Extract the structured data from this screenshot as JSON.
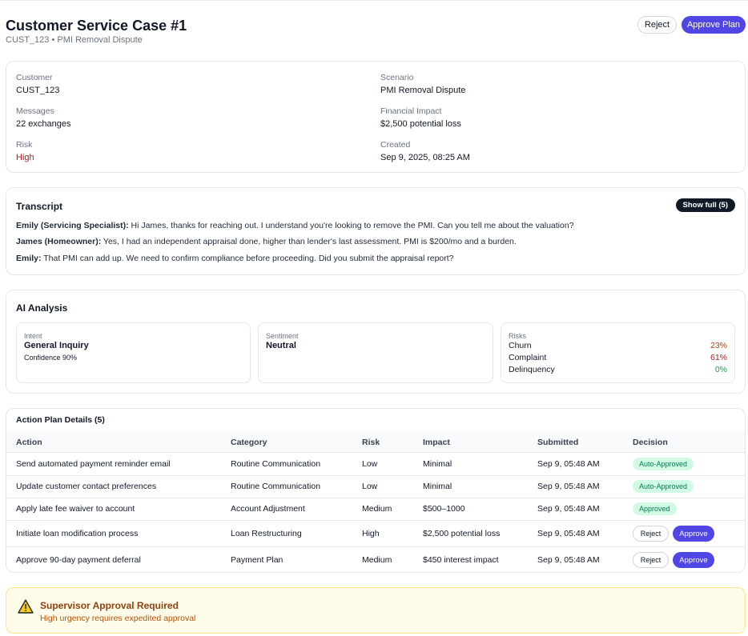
{
  "header": {
    "title": "Customer Service Case #1",
    "subtitle": "CUST_123 • PMI Removal Dispute",
    "reject_label": "Reject",
    "approve_label": "Approve Plan"
  },
  "info": {
    "customer": {
      "label": "Customer",
      "value": "CUST_123"
    },
    "messages": {
      "label": "Messages",
      "value": "22 exchanges"
    },
    "risk": {
      "label": "Risk",
      "value": "High"
    },
    "scenario": {
      "label": "Scenario",
      "value": "PMI Removal Dispute"
    },
    "financial": {
      "label": "Financial Impact",
      "value": "$2,500 potential loss"
    },
    "created": {
      "label": "Created",
      "value": "Sep 9, 2025, 08:25 AM"
    }
  },
  "transcript": {
    "title": "Transcript",
    "show_full_label": "Show full (5)",
    "messages": [
      {
        "speaker": "Emily (Servicing Specialist):",
        "text": " Hi James, thanks for reaching out. I understand you're looking to remove the PMI. Can you tell me about the valuation?"
      },
      {
        "speaker": "James (Homeowner):",
        "text": " Yes, I had an independent appraisal done, higher than lender's last assessment. PMI is $200/mo and a burden."
      },
      {
        "speaker": "Emily:",
        "text": " That PMI can add up. We need to confirm compliance before proceeding. Did you submit the appraisal report?"
      }
    ]
  },
  "ai": {
    "title": "AI Analysis",
    "intent": {
      "label": "Intent",
      "value": "General Inquiry",
      "confidence": "Confidence 90%"
    },
    "sentiment": {
      "label": "Sentiment",
      "value": "Neutral"
    },
    "risks": {
      "label": "Risks",
      "items": [
        {
          "name": "Churn",
          "value": "23%",
          "color": "#c2410c"
        },
        {
          "name": "Complaint",
          "value": "61%",
          "color": "#b91c1c"
        },
        {
          "name": "Delinquency",
          "value": "0%",
          "color": "#16a34a"
        }
      ]
    }
  },
  "plan": {
    "title": "Action Plan Details (5)",
    "columns": [
      "Action",
      "Category",
      "Risk",
      "Impact",
      "Submitted",
      "Decision"
    ],
    "rows": [
      {
        "action": "Send automated payment reminder email",
        "category": "Routine Communication",
        "risk": "Low",
        "impact": "Minimal",
        "submitted": "Sep 9, 05:48 AM",
        "decision": "Auto-Approved"
      },
      {
        "action": "Update customer contact preferences",
        "category": "Routine Communication",
        "risk": "Low",
        "impact": "Minimal",
        "submitted": "Sep 9, 05:48 AM",
        "decision": "Auto-Approved"
      },
      {
        "action": "Apply late fee waiver to account",
        "category": "Account Adjustment",
        "risk": "Medium",
        "impact": "$500–1000",
        "submitted": "Sep 9, 05:48 AM",
        "decision": "Approved"
      },
      {
        "action": "Initiate loan modification process",
        "category": "Loan Restructuring",
        "risk": "High",
        "impact": "$2,500 potential loss",
        "submitted": "Sep 9, 05:48 AM",
        "reject_label": "Reject",
        "approve_label": "Approve"
      },
      {
        "action": "Approve 90-day payment deferral",
        "category": "Payment Plan",
        "risk": "Medium",
        "impact": "$450 interest impact",
        "submitted": "Sep 9, 05:48 AM",
        "reject_label": "Reject",
        "approve_label": "Approve"
      }
    ]
  },
  "alert": {
    "title": "Supervisor Approval Required",
    "text": "High urgency requires expedited approval",
    "icon": "warning-icon"
  },
  "colors": {
    "accent": "#4f46e5",
    "badge_bg": "#d1fae5",
    "badge_text": "#047857",
    "alert_bg": "#fefce8"
  }
}
